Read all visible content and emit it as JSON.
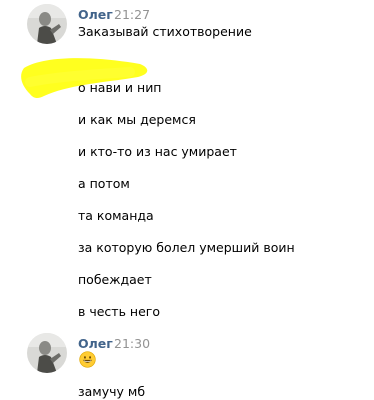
{
  "messages": [
    {
      "author": "Олег",
      "time": "21:27",
      "lines": [
        "Заказывай стихотворение",
        "о нави и нип",
        "и как мы деремся",
        "и кто-то из нас умирает",
        "а потом",
        "та команда",
        "за которую болел умерший воин",
        "побеждает",
        "в честь него"
      ]
    },
    {
      "author": "Олег",
      "time": "21:30",
      "emoji_icon": "grinning-face-emoji",
      "lines": [
        "замучу мб"
      ]
    }
  ],
  "colors": {
    "author": "#42648b",
    "time": "#939393",
    "highlight": "#ffff00"
  }
}
